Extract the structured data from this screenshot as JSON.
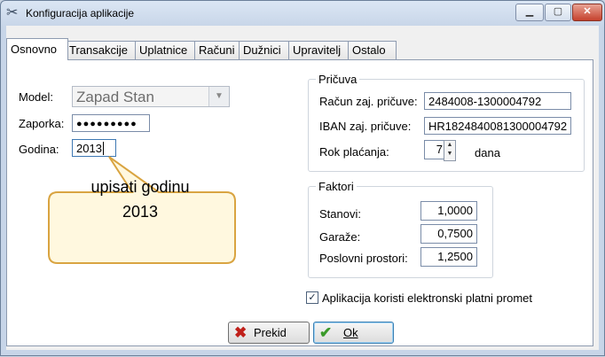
{
  "window": {
    "title": "Konfiguracija aplikacije",
    "icon": "tools-icon",
    "controls": {
      "minimize": "▁",
      "maximize": "▢",
      "close": "✕"
    }
  },
  "tabs": [
    {
      "label": "Osnovno",
      "active": true
    },
    {
      "label": "Transakcije"
    },
    {
      "label": "Uplatnice"
    },
    {
      "label": "Računi"
    },
    {
      "label": "Dužnici"
    },
    {
      "label": "Upravitelj"
    },
    {
      "label": "Ostalo"
    }
  ],
  "basic": {
    "model_label": "Model:",
    "model_value": "Zapad Stan",
    "password_label": "Zaporka:",
    "password_value": "●●●●●●●●●",
    "year_label": "Godina:",
    "year_value": "2013"
  },
  "callout": {
    "line1": "upisati godinu",
    "line2": "2013"
  },
  "reserve": {
    "title": "Pričuva",
    "account_label": "Račun zaj. pričuve:",
    "account_value": "2484008-1300004792",
    "iban_label": "IBAN zaj. pričuve:",
    "iban_value": "HR1824840081300004792",
    "due_label": "Rok plaćanja:",
    "due_value": "7",
    "due_unit": "dana"
  },
  "factors": {
    "title": "Faktori",
    "rows": [
      {
        "label": "Stanovi:",
        "value": "1,0000"
      },
      {
        "label": "Garaže:",
        "value": "0,7500"
      },
      {
        "label": "Poslovni prostori:",
        "value": "1,2500"
      }
    ]
  },
  "electronic_payment": {
    "label": "Aplikacija koristi elektronski platni promet",
    "checked": true
  },
  "buttons": {
    "cancel": {
      "label": "Prekid",
      "icon": "✖",
      "icon_color": "#c0201a"
    },
    "ok": {
      "label": "Ok",
      "icon": "✔",
      "icon_color": "#3a9a2a"
    }
  }
}
